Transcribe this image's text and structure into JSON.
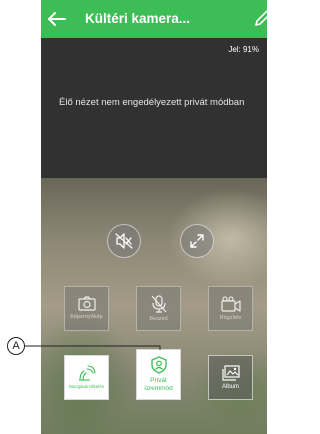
{
  "header": {
    "title": "Kültéri kamera...",
    "bg_color": "#3dbd55",
    "back_icon": "arrow-left-icon",
    "edit_icon": "pencil-icon"
  },
  "video": {
    "signal_text": "Jel: 91%",
    "privacy_message": "Élő nézet nem engedélyezett privát módban"
  },
  "round_controls": [
    {
      "icon": "speaker-muted-icon"
    },
    {
      "icon": "fullscreen-expand-icon"
    }
  ],
  "actions_row1": [
    {
      "label": "Képernyőkép",
      "icon": "camera-icon",
      "enabled": false
    },
    {
      "label": "Beszéd",
      "icon": "microphone-muted-icon",
      "enabled": false
    },
    {
      "label": "Rögzítés",
      "icon": "video-record-icon",
      "enabled": false
    }
  ],
  "actions_row2": [
    {
      "label": "Mozgásérzékelés",
      "icon": "motion-detection-icon"
    },
    {
      "label": "Privát üzemmód",
      "label_line1": "Privát",
      "label_line2": "üzemmód",
      "icon": "privacy-shield-icon"
    },
    {
      "label": "Album",
      "icon": "album-icon"
    }
  ],
  "annotation": {
    "label": "A"
  },
  "colors": {
    "accent": "#3dbd55"
  }
}
